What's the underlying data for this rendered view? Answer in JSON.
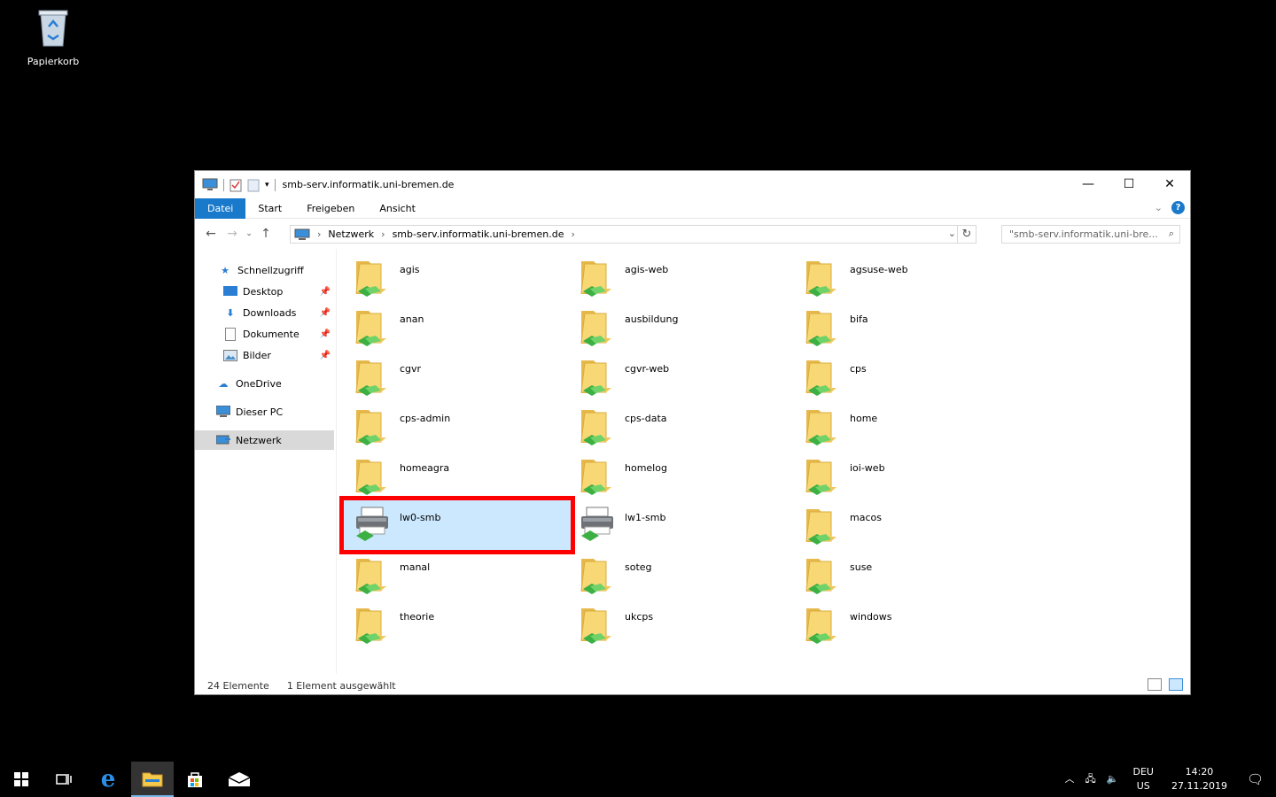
{
  "desktop": {
    "recycle_bin_label": "Papierkorb"
  },
  "window": {
    "title": "smb-serv.informatik.uni-bremen.de",
    "ribbon": {
      "tabs": [
        "Datei",
        "Start",
        "Freigeben",
        "Ansicht"
      ]
    },
    "address": {
      "segments": [
        "Netzwerk",
        "smb-serv.informatik.uni-bremen.de"
      ]
    },
    "search": {
      "placeholder": "\"smb-serv.informatik.uni-bre..."
    },
    "sidebar": {
      "quick_access": "Schnellzugriff",
      "items": [
        "Desktop",
        "Downloads",
        "Dokumente",
        "Bilder"
      ],
      "onedrive": "OneDrive",
      "this_pc": "Dieser PC",
      "network": "Netzwerk"
    },
    "shares": [
      {
        "name": "agis",
        "type": "folder"
      },
      {
        "name": "agis-web",
        "type": "folder"
      },
      {
        "name": "agsuse-web",
        "type": "folder"
      },
      {
        "name": "anan",
        "type": "folder"
      },
      {
        "name": "ausbildung",
        "type": "folder"
      },
      {
        "name": "bifa",
        "type": "folder"
      },
      {
        "name": "cgvr",
        "type": "folder"
      },
      {
        "name": "cgvr-web",
        "type": "folder"
      },
      {
        "name": "cps",
        "type": "folder"
      },
      {
        "name": "cps-admin",
        "type": "folder"
      },
      {
        "name": "cps-data",
        "type": "folder"
      },
      {
        "name": "home",
        "type": "folder"
      },
      {
        "name": "homeagra",
        "type": "folder"
      },
      {
        "name": "homelog",
        "type": "folder"
      },
      {
        "name": "ioi-web",
        "type": "folder"
      },
      {
        "name": "lw0-smb",
        "type": "printer",
        "selected": true
      },
      {
        "name": "lw1-smb",
        "type": "printer"
      },
      {
        "name": "macos",
        "type": "folder"
      },
      {
        "name": "manal",
        "type": "folder"
      },
      {
        "name": "soteg",
        "type": "folder"
      },
      {
        "name": "suse",
        "type": "folder"
      },
      {
        "name": "theorie",
        "type": "folder"
      },
      {
        "name": "ukcps",
        "type": "folder"
      },
      {
        "name": "windows",
        "type": "folder"
      }
    ],
    "status": {
      "count": "24 Elemente",
      "selection": "1 Element ausgewählt"
    }
  },
  "taskbar": {
    "lang": "DEU",
    "layout": "US",
    "time": "14:20",
    "date": "27.11.2019"
  }
}
